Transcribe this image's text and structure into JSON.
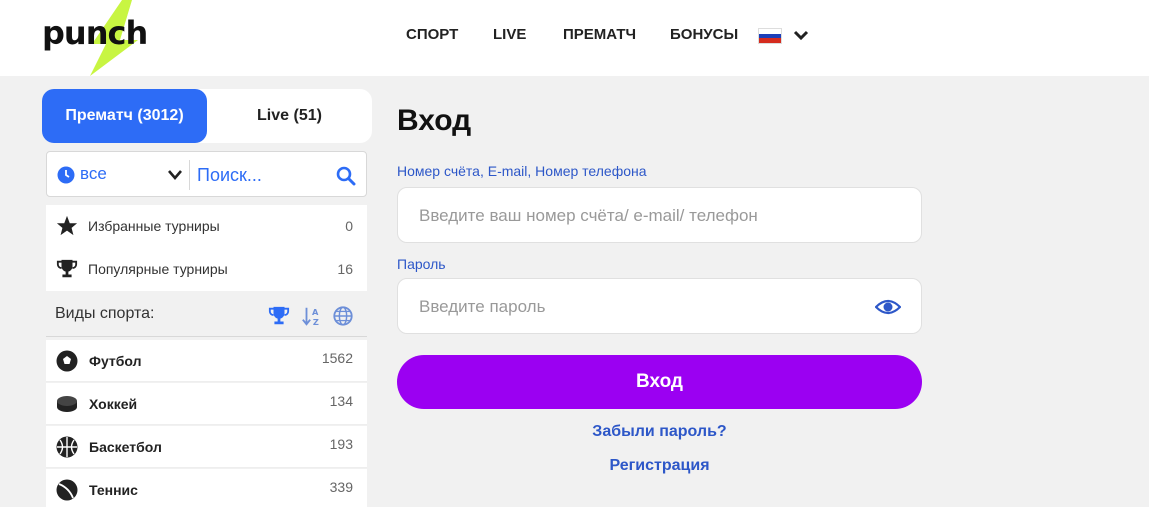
{
  "header": {
    "logo_text": "punch",
    "nav": [
      "СПОРТ",
      "LIVE",
      "ПРЕМАТЧ",
      "БОНУСЫ"
    ],
    "language_flag": "russia-flag",
    "colors": {
      "logo_bolt": "#c8f542"
    }
  },
  "sidebar": {
    "tabs": [
      {
        "label": "Прематч (3012)",
        "active": true
      },
      {
        "label": "Live (51)",
        "active": false
      }
    ],
    "filter": {
      "selected": "все",
      "search_placeholder": "Поиск..."
    },
    "favorites": [
      {
        "label": "Избранные турниры",
        "count": "0",
        "icon": "star-icon"
      },
      {
        "label": "Популярные турниры",
        "count": "16",
        "icon": "trophy-icon"
      }
    ],
    "sports_header": "Виды спорта:",
    "sports": [
      {
        "label": "Футбол",
        "count": "1562",
        "icon": "soccer-ball-icon"
      },
      {
        "label": "Хоккей",
        "count": "134",
        "icon": "hockey-puck-icon"
      },
      {
        "label": "Баскетбол",
        "count": "193",
        "icon": "basketball-icon"
      },
      {
        "label": "Теннис",
        "count": "339",
        "icon": "tennis-ball-icon"
      }
    ]
  },
  "login": {
    "title": "Вход",
    "account_label": "Номер счёта, E-mail, Номер телефона",
    "account_placeholder": "Введите ваш номер счёта/ e-mail/ телефон",
    "password_label": "Пароль",
    "password_placeholder": "Введите пароль",
    "submit_label": "Вход",
    "forgot_password": "Забыли пароль?",
    "register": "Регистрация",
    "colors": {
      "accent": "#2d6cf6",
      "button": "#9b00f2",
      "link": "#2d57c8"
    }
  }
}
